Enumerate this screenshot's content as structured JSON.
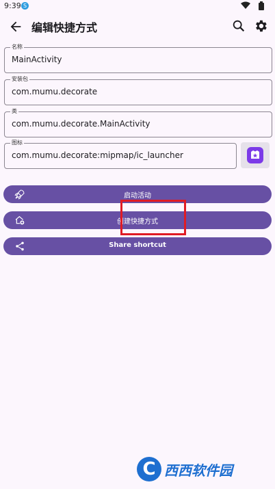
{
  "status_bar": {
    "time": "9:39",
    "notification_badge": "S"
  },
  "app_bar": {
    "title": "编辑快捷方式"
  },
  "fields": {
    "name": {
      "label": "名称",
      "value": "MainActivity"
    },
    "package": {
      "label": "安装包",
      "value": "com.mumu.decorate"
    },
    "class": {
      "label": "类",
      "value": "com.mumu.decorate.MainActivity"
    },
    "icon": {
      "label": "图标",
      "value": "com.mumu.decorate:mipmap/ic_launcher"
    }
  },
  "buttons": {
    "launch": "启动活动",
    "create": "创建快捷方式",
    "share": "Share shortcut"
  },
  "watermark": {
    "text": "西西软件园",
    "logo_letter": "C"
  },
  "colors": {
    "accent": "#6750a4",
    "background": "#fcf6fd",
    "highlight": "#e01b24"
  }
}
